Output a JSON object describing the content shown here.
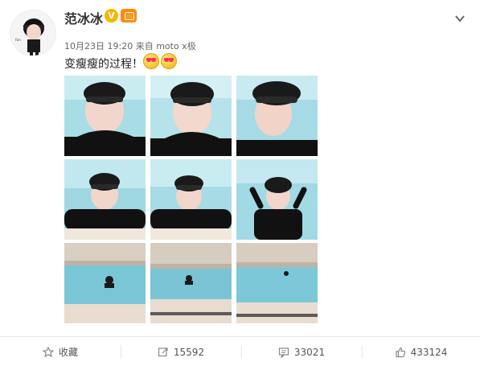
{
  "post": {
    "username": "范冰冰",
    "verified_badge": "V",
    "timestamp": "10月23日 19:20",
    "source": "来自 moto x极",
    "text": "变瘦瘦的过程！",
    "emoji_icons": [
      "heart-eyes-icon",
      "heart-eyes-icon"
    ],
    "images": [
      {
        "name": "photo-1"
      },
      {
        "name": "photo-2"
      },
      {
        "name": "photo-3"
      },
      {
        "name": "photo-4"
      },
      {
        "name": "photo-5"
      },
      {
        "name": "photo-6"
      },
      {
        "name": "photo-7"
      },
      {
        "name": "photo-8"
      },
      {
        "name": "photo-9"
      }
    ]
  },
  "actions": {
    "favorite": {
      "label": "收藏",
      "icon": "star-icon"
    },
    "repost": {
      "count": "15592",
      "icon": "repost-icon"
    },
    "comment": {
      "count": "33021",
      "icon": "comment-icon"
    },
    "like": {
      "count": "433124",
      "icon": "thumbs-up-icon"
    }
  },
  "colors": {
    "vip_gold": "#f7b500",
    "accent_orange": "#ff8a00",
    "pool_blue": "#8fd2df"
  }
}
